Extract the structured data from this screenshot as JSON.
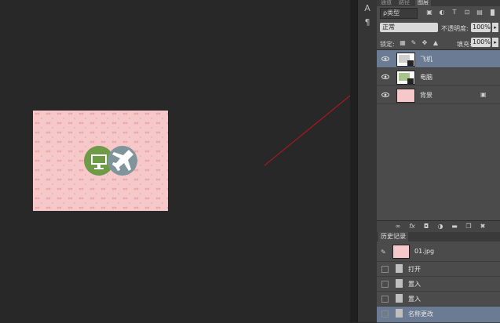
{
  "panel_tabs": {
    "channels": "通道",
    "paths": "路径",
    "layers": "图层"
  },
  "filter": {
    "label": "ρ类型"
  },
  "blend_mode": {
    "value": "正常"
  },
  "opacity": {
    "label": "不透明度:",
    "value": "100%"
  },
  "lock": {
    "label": "锁定:"
  },
  "fill": {
    "label": "填充:",
    "value": "100%"
  },
  "layers": [
    {
      "name": "飞机",
      "selected": true
    },
    {
      "name": "电脑",
      "selected": false
    },
    {
      "name": "背景",
      "selected": false
    }
  ],
  "layer_footer": {
    "fx_label": "fx"
  },
  "history": {
    "tab_label": "历史记录",
    "snapshot": "01.jpg",
    "items": [
      {
        "name": "打开",
        "selected": false
      },
      {
        "name": "置入",
        "selected": false
      },
      {
        "name": "置入",
        "selected": false
      },
      {
        "name": "名称更改",
        "selected": true
      }
    ]
  },
  "tool_column": {
    "type_tool": "A",
    "paragraph": "¶"
  },
  "colors": {
    "accent_selected": "#6b7b93",
    "doc_bg": "#f6c8c9",
    "arrow": "#c0141b"
  }
}
